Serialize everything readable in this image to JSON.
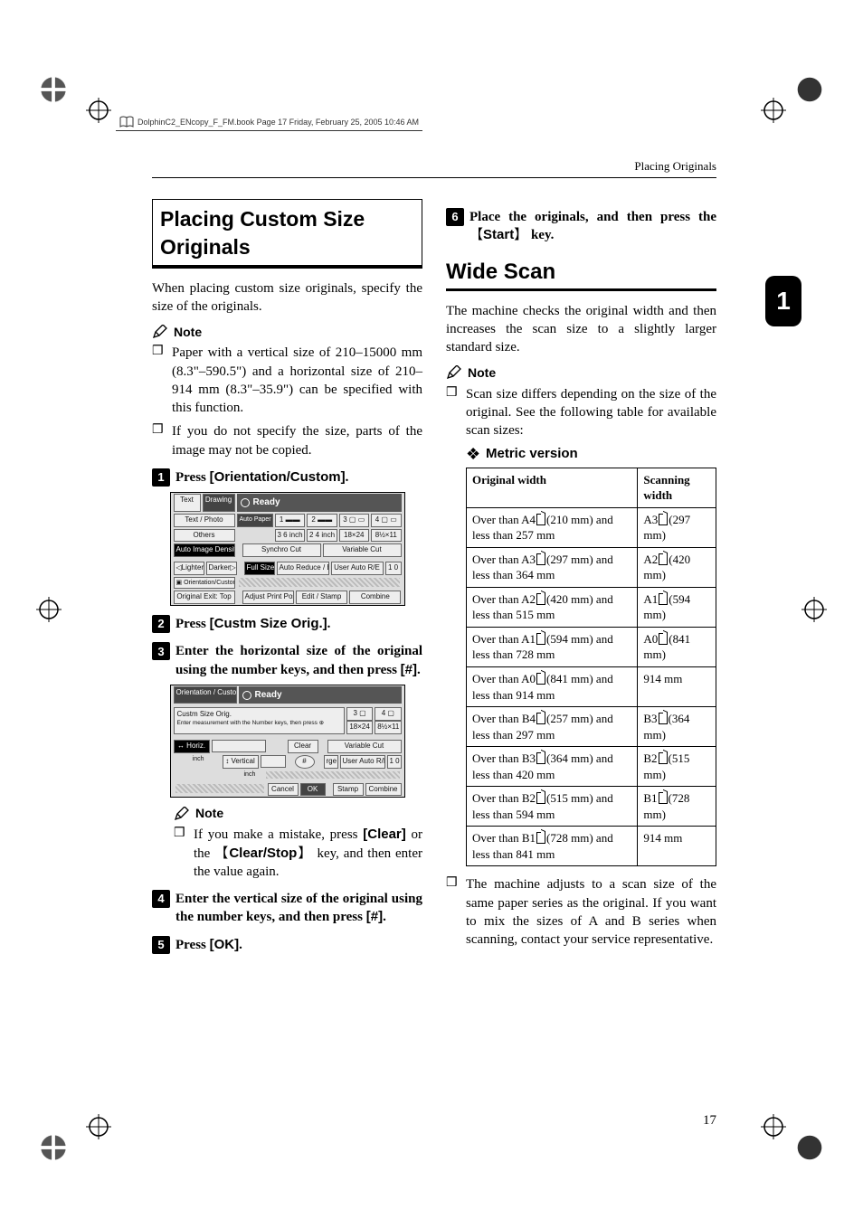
{
  "meta": {
    "header_line": "DolphinC2_ENcopy_F_FM.book  Page 17  Friday, February 25, 2005  10:46 AM",
    "running_head": "Placing Originals",
    "chapter_tab": "1",
    "page_number": "17"
  },
  "left": {
    "h2": "Placing Custom Size Originals",
    "intro": "When placing custom size originals, specify the size of the originals.",
    "note_label": "Note",
    "notes": [
      "Paper with a vertical size of 210–15000 mm (8.3\"–590.5\") and a horizontal size of 210–914 mm (8.3\"–35.9\") can be specified with this function.",
      "If you do not specify the size, parts of the image may not be copied."
    ],
    "steps": {
      "s1_pre": "Press ",
      "s1_btn": "[Orientation/Custom]",
      "s1_post": ".",
      "s2_pre": "Press ",
      "s2_btn": "[Custm Size Orig.]",
      "s2_post": ".",
      "s3_a": "Enter the horizontal size of the original using the number keys, and then press ",
      "s3_btn": "[#]",
      "s3_b": ".",
      "s3_note_a": "If you make a mistake, press ",
      "s3_note_btn1": "[Clear]",
      "s3_note_b": " or the ",
      "s3_note_key": "Clear/Stop",
      "s3_note_c": " key, and then enter the value again.",
      "s4_a": "Enter the vertical size of the original using the number keys, and then press ",
      "s4_btn": "[#]",
      "s4_b": ".",
      "s5_pre": "Press ",
      "s5_btn": "[OK]",
      "s5_post": "."
    },
    "screenshot1": {
      "ready": "Ready",
      "cells": [
        "Text",
        "Drawing",
        "Text / Photo",
        "Others",
        "Auto Image Density",
        "◁Lighter",
        "Darker▷",
        "Orientation/Custom",
        "Original Exit: Top",
        "Auto Paper Select▶",
        "3 6 inch",
        "2 4 inch",
        "18×24",
        "8½×11",
        "Synchro Cut",
        "Variable Cut",
        "Full Size",
        "Auto Reduce / Enlarge",
        "User Auto R/E",
        "1 0",
        "Adjust Print Position",
        "Edit / Stamp",
        "Combine"
      ]
    },
    "screenshot2": {
      "ready": "Ready",
      "cells": [
        "Orientation / Custom",
        "Custm Size Orig.",
        "Enter measurement with the Number keys, then press ⊕",
        "↔ Horiz.",
        "inch",
        "↕ Vertical",
        "inch",
        "Clear",
        "#",
        "Cancel",
        "OK",
        "18×24",
        "8½×11",
        "Variable Cut",
        "User Auto R/E",
        "1 0",
        "Stamp",
        "Combine"
      ]
    }
  },
  "right": {
    "s6_a": "Place the originals, and then press the ",
    "s6_key": "Start",
    "s6_b": " key.",
    "h2": "Wide Scan",
    "intro": "The machine checks the original width and then increases the scan size to a slightly larger standard size.",
    "note_label": "Note",
    "notes": [
      "Scan size differs depending on the size of the original. See the following table for available scan sizes:"
    ],
    "h3": "Metric version",
    "table": {
      "h1": "Original width",
      "h2": "Scanning width",
      "rows": [
        {
          "a_pre": "Over than A4",
          "a_dim": "(210 mm)",
          "a_suf": "and less than 257 mm",
          "b_pre": "A3",
          "b_dim": "(297 mm)"
        },
        {
          "a_pre": "Over than A3",
          "a_dim": "(297 mm)",
          "a_suf": "and less than 364 mm",
          "b_pre": "A2",
          "b_dim": "(420 mm)"
        },
        {
          "a_pre": "Over than A2",
          "a_dim": "(420 mm)",
          "a_suf": "and less than 515 mm",
          "b_pre": "A1",
          "b_dim": "(594 mm)"
        },
        {
          "a_pre": "Over than A1",
          "a_dim": "(594 mm)",
          "a_suf": "and less than 728 mm",
          "b_pre": "A0",
          "b_dim": "(841 mm)"
        },
        {
          "a_pre": "Over than A0",
          "a_dim": "(841 mm)",
          "a_suf": "and less than 914 mm",
          "b_pre": "914 mm",
          "b_dim": ""
        },
        {
          "a_pre": "Over than B4",
          "a_dim": "(257 mm)",
          "a_suf": "and less than 297 mm",
          "b_pre": "B3",
          "b_dim": "(364 mm)"
        },
        {
          "a_pre": "Over than B3",
          "a_dim": "(364 mm)",
          "a_suf": "and less than 420 mm",
          "b_pre": "B2",
          "b_dim": "(515 mm)"
        },
        {
          "a_pre": "Over than B2",
          "a_dim": "(515 mm)",
          "a_suf": "and less than 594 mm",
          "b_pre": "B1",
          "b_dim": "(728 mm)"
        },
        {
          "a_pre": "Over than B1",
          "a_dim": "(728 mm)",
          "a_suf": "and less than 841 mm",
          "b_pre": "914 mm",
          "b_dim": ""
        }
      ]
    },
    "after_table": "The machine adjusts to a scan size of the same paper series as the original. If you want to mix the sizes of A and B series when scanning, contact your service representative."
  }
}
